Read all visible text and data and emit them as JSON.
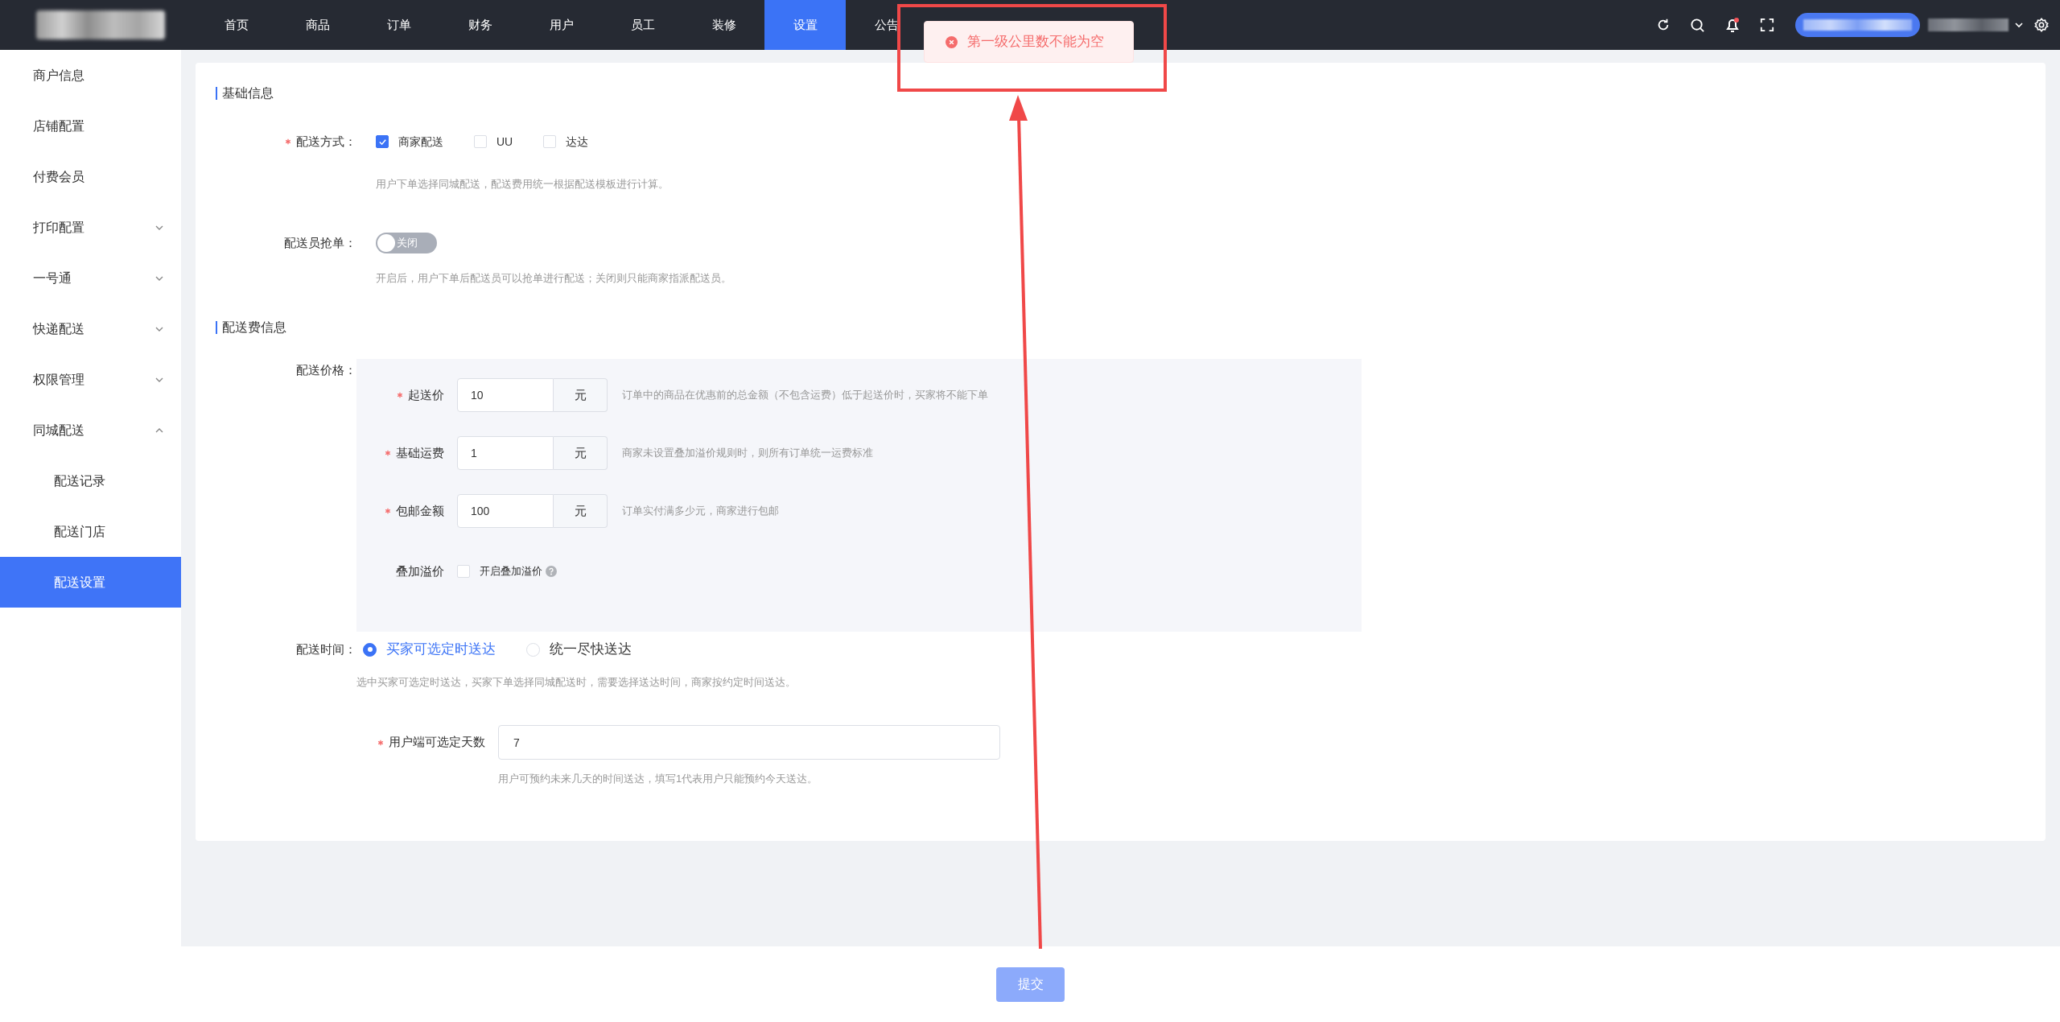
{
  "top_nav": {
    "items": [
      {
        "label": "首页",
        "selected": false
      },
      {
        "label": "商品",
        "selected": false
      },
      {
        "label": "订单",
        "selected": false
      },
      {
        "label": "财务",
        "selected": false
      },
      {
        "label": "用户",
        "selected": false
      },
      {
        "label": "员工",
        "selected": false
      },
      {
        "label": "装修",
        "selected": false
      },
      {
        "label": "设置",
        "selected": true
      },
      {
        "label": "公告",
        "selected": false
      }
    ]
  },
  "toast": {
    "message": "第一级公里数不能为空"
  },
  "sidebar": {
    "items": [
      {
        "kind": "link",
        "label": "商户信息",
        "selected": false
      },
      {
        "kind": "link",
        "label": "店铺配置",
        "selected": false
      },
      {
        "kind": "link",
        "label": "付费会员",
        "selected": false
      },
      {
        "kind": "group",
        "label": "打印配置",
        "expanded": false,
        "selected": false
      },
      {
        "kind": "group",
        "label": "一号通",
        "expanded": false,
        "selected": false
      },
      {
        "kind": "group",
        "label": "快递配送",
        "expanded": false,
        "selected": false
      },
      {
        "kind": "group",
        "label": "权限管理",
        "expanded": false,
        "selected": false
      },
      {
        "kind": "group",
        "label": "同城配送",
        "expanded": true,
        "selected": false,
        "children": [
          {
            "label": "配送记录",
            "selected": false
          },
          {
            "label": "配送门店",
            "selected": false
          },
          {
            "label": "配送设置",
            "selected": true
          }
        ]
      }
    ]
  },
  "basic_info": {
    "title": "基础信息",
    "delivery_method": {
      "label": "配送方式：",
      "required": true,
      "options": [
        {
          "label": "商家配送",
          "checked": true
        },
        {
          "label": "UU",
          "checked": false
        },
        {
          "label": "达达",
          "checked": false
        }
      ],
      "hint": "用户下单选择同城配送，配送费用统一根据配送模板进行计算。"
    },
    "courier_grab": {
      "label": "配送员抢单：",
      "on": false,
      "switch_text": "关闭",
      "hint": "开启后，用户下单后配送员可以抢单进行配送；关闭则只能商家指派配送员。"
    }
  },
  "fee_info": {
    "title": "配送费信息",
    "price": {
      "label": "配送价格：",
      "rows": [
        {
          "kind": "amount",
          "label": "起送价",
          "required": true,
          "value": "10",
          "unit": "元",
          "hint": "订单中的商品在优惠前的总金额（不包含运费）低于起送价时，买家将不能下单"
        },
        {
          "kind": "amount",
          "label": "基础运费",
          "required": true,
          "value": "1",
          "unit": "元",
          "hint": "商家未设置叠加溢价规则时，则所有订单统一运费标准"
        },
        {
          "kind": "amount",
          "label": "包邮金额",
          "required": true,
          "value": "100",
          "unit": "元",
          "hint": "订单实付满多少元，商家进行包邮"
        },
        {
          "kind": "checkbox",
          "label": "叠加溢价",
          "checkbox_label": "开启叠加溢价",
          "checked": false
        }
      ]
    },
    "delivery_time": {
      "label": "配送时间：",
      "options": [
        {
          "label": "买家可选定时送达",
          "selected": true
        },
        {
          "label": "统一尽快送达",
          "selected": false
        }
      ],
      "hint": "选中买家可选定时送达，买家下单选择同城配送时，需要选择送达时间，商家按约定时间送达。"
    },
    "days": {
      "label": "用户端可选定天数",
      "required": true,
      "value": "7",
      "hint": "用户可预约未来几天的时间送达，填写1代表用户只能预约今天送达。"
    }
  },
  "submit": {
    "label": "提交"
  }
}
